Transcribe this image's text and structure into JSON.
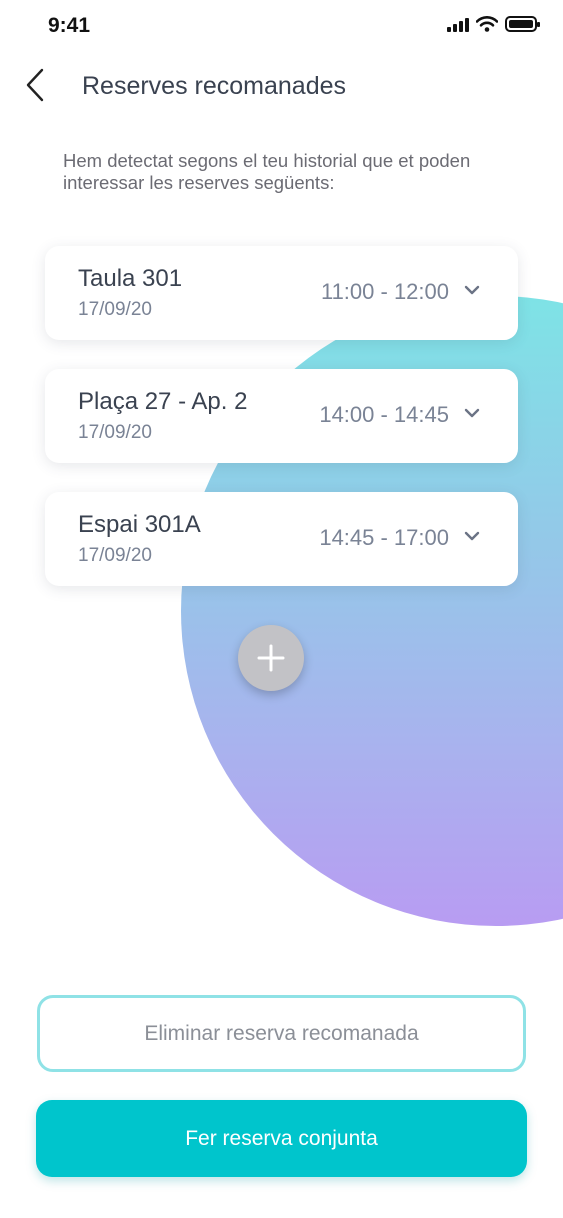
{
  "status_bar": {
    "time": "9:41",
    "icons": [
      "signal-icon",
      "wifi-icon",
      "battery-icon"
    ]
  },
  "header": {
    "back_icon": "chevron-left-icon",
    "title": "Reserves recomanades"
  },
  "intro_text": "Hem detectat segons el teu historial que et poden interessar les reserves següents:",
  "reservations": [
    {
      "name": "Taula 301",
      "date": "17/09/20",
      "time": "11:00 - 12:00"
    },
    {
      "name": "Plaça 27 - Ap. 2",
      "date": "17/09/20",
      "time": "14:00 - 14:45"
    },
    {
      "name": "Espai 301A",
      "date": "17/09/20",
      "time": "14:45 - 17:00"
    }
  ],
  "add_button_icon": "plus-icon",
  "actions": {
    "delete_label": "Eliminar reserva recomanada",
    "book_label": "Fer reserva conjunta"
  },
  "colors": {
    "primary": "#00c5cc",
    "outline": "#8fe2e6",
    "gradient_top": "#7ee3e6",
    "gradient_bottom": "#b89cf2",
    "text_dark": "#3a4250",
    "text_muted": "#7a8395"
  }
}
